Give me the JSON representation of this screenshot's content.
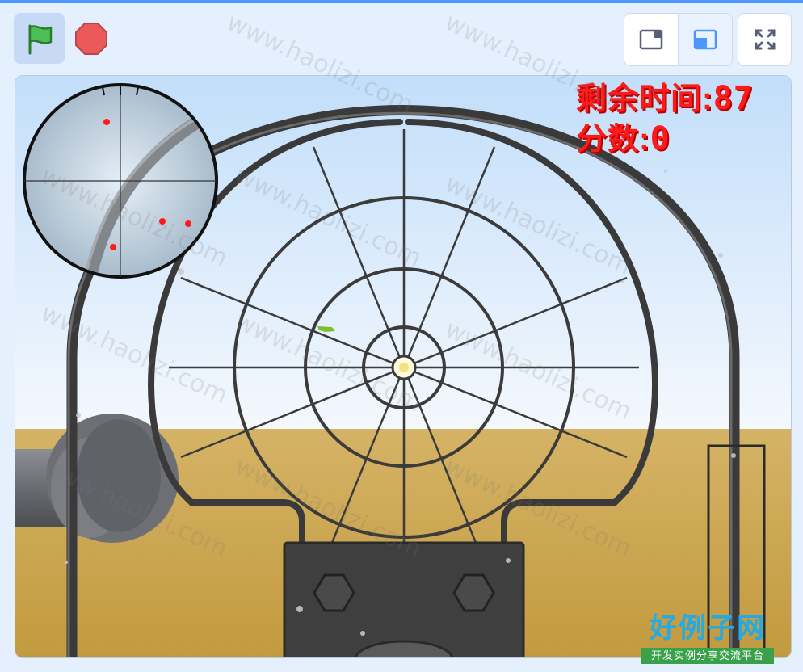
{
  "toolbar": {
    "green_flag": "green-flag-icon",
    "stop": "stop-sign-icon",
    "small_stage": "small-stage-icon",
    "normal_stage": "normal-stage-icon",
    "fullscreen": "fullscreen-icon"
  },
  "hud": {
    "time_label": "剩余时间:",
    "time_value": "87",
    "score_label": "分数:",
    "score_value": "0"
  },
  "watermark": {
    "text": "www.haolizi.com",
    "logo_title": "好例子网",
    "logo_subtitle": "开发实例分享交流平台"
  },
  "colors": {
    "accent": "#4c97ff",
    "hud_red": "#ff1a1a",
    "sky_top": "#c7e1fb",
    "ground": "#c8a552",
    "frame": "#3a3a3a"
  }
}
